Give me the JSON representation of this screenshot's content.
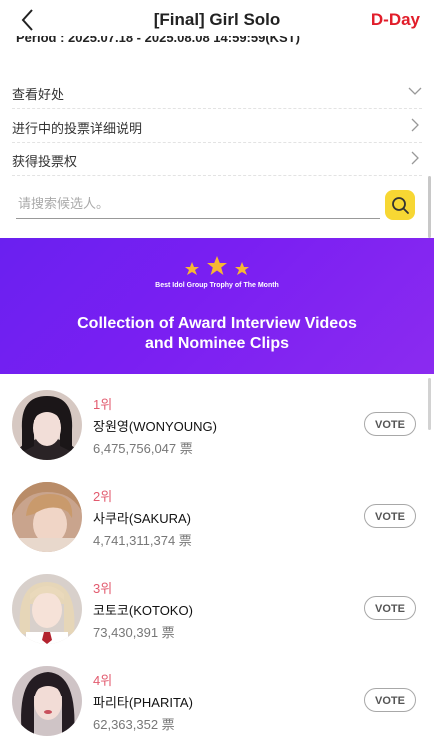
{
  "header": {
    "title": "[Final] Girl Solo",
    "dday": "D-Day",
    "period": "Period : 2025.07.18 - 2025.08.08 14:59:59(KST)"
  },
  "menu": {
    "rows": [
      {
        "label": "查看好处",
        "icon": "chevron-down-icon"
      },
      {
        "label": "进行中的投票详细说明",
        "icon": "chevron-right-icon"
      },
      {
        "label": "获得投票权",
        "icon": "chevron-right-icon"
      }
    ]
  },
  "search": {
    "placeholder": "请搜索候选人。",
    "value": "",
    "button_color": "#f7d733"
  },
  "banner": {
    "subtitle": "Best Idol Group Trophy of The Month",
    "title_line1": "Collection of Award Interview Videos",
    "title_line2": "and Nominee Clips",
    "bg_color": "#7a1ff2",
    "star_color": "#f7b733"
  },
  "ranking": [
    {
      "rank": "1위",
      "name": "장원영(WONYOUNG)",
      "votes": "6,475,756,047 票",
      "vote_label": "VOTE"
    },
    {
      "rank": "2위",
      "name": "사쿠라(SAKURA)",
      "votes": "4,741,311,374 票",
      "vote_label": "VOTE"
    },
    {
      "rank": "3위",
      "name": "코토코(KOTOKO)",
      "votes": "73,430,391 票",
      "vote_label": "VOTE"
    },
    {
      "rank": "4위",
      "name": "파리타(PHARITA)",
      "votes": "62,363,352 票",
      "vote_label": "VOTE"
    }
  ],
  "colors": {
    "rank_text": "#e25a6e",
    "dday": "#e11d2a"
  }
}
